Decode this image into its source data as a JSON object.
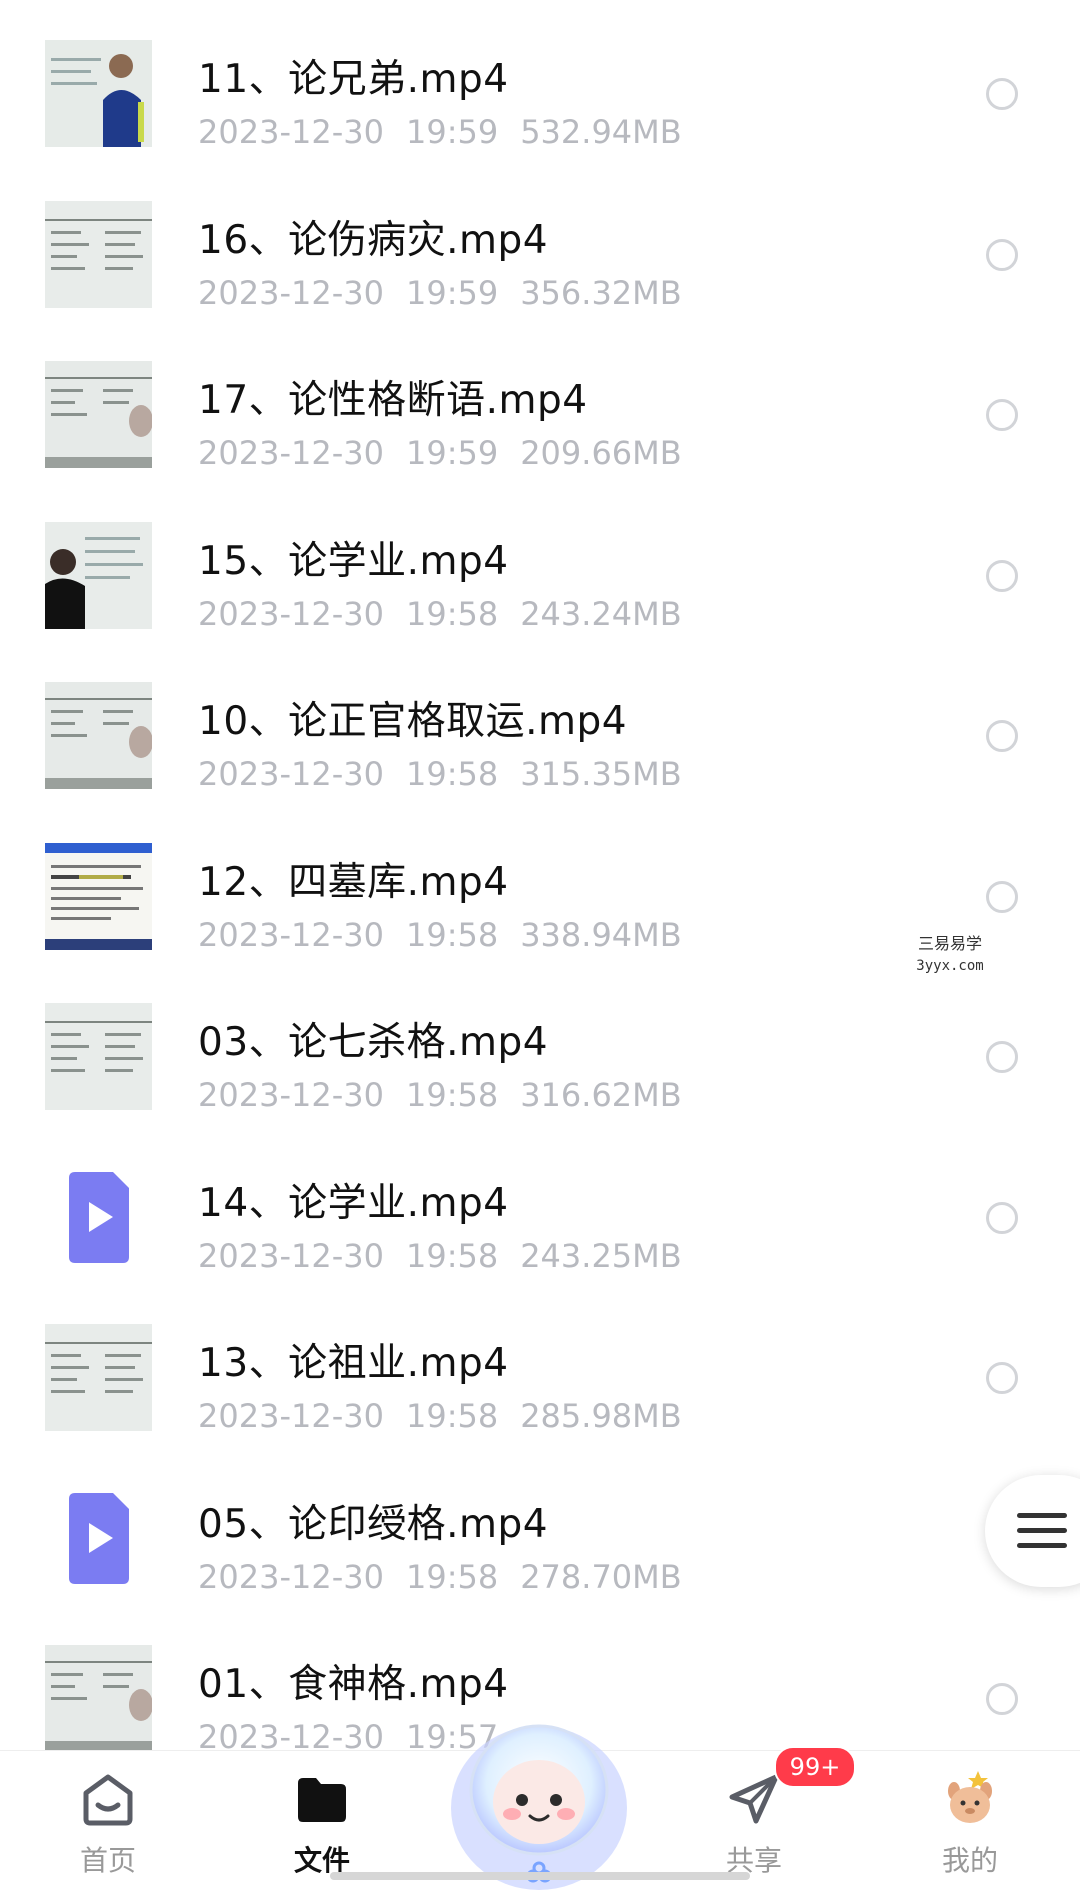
{
  "files": [
    {
      "name": "11、论兄弟.mp4",
      "date": "2023-12-30",
      "time": "19:59",
      "size": "532.94MB",
      "thumb": "man-whiteboard"
    },
    {
      "name": "16、论伤病灾.mp4",
      "date": "2023-12-30",
      "time": "19:59",
      "size": "356.32MB",
      "thumb": "whiteboard-text"
    },
    {
      "name": "17、论性格断语.mp4",
      "date": "2023-12-30",
      "time": "19:59",
      "size": "209.66MB",
      "thumb": "whiteboard-hand"
    },
    {
      "name": "15、论学业.mp4",
      "date": "2023-12-30",
      "time": "19:58",
      "size": "243.24MB",
      "thumb": "man-whiteboard-dark"
    },
    {
      "name": "10、论正官格取运.mp4",
      "date": "2023-12-30",
      "time": "19:58",
      "size": "315.35MB",
      "thumb": "whiteboard-hand"
    },
    {
      "name": "12、四墓库.mp4",
      "date": "2023-12-30",
      "time": "19:58",
      "size": "338.94MB",
      "thumb": "document"
    },
    {
      "name": "03、论七杀格.mp4",
      "date": "2023-12-30",
      "time": "19:58",
      "size": "316.62MB",
      "thumb": "whiteboard-text"
    },
    {
      "name": "14、论学业.mp4",
      "date": "2023-12-30",
      "time": "19:58",
      "size": "243.25MB",
      "thumb": "video-icon"
    },
    {
      "name": "13、论祖业.mp4",
      "date": "2023-12-30",
      "time": "19:58",
      "size": "285.98MB",
      "thumb": "whiteboard-text"
    },
    {
      "name": "05、论印绶格.mp4",
      "date": "2023-12-30",
      "time": "19:58",
      "size": "278.70MB",
      "thumb": "video-icon"
    },
    {
      "name": "01、食神格.mp4",
      "date": "2023-12-30",
      "time": "19:57",
      "size": "",
      "thumb": "whiteboard-hand"
    }
  ],
  "watermark": {
    "line1": "三易易学",
    "line2": "3yyx.com"
  },
  "tabs": [
    {
      "label": "首页",
      "icon": "home-icon"
    },
    {
      "label": "文件",
      "icon": "folder-icon"
    },
    {
      "label": "",
      "icon": "mascot-icon"
    },
    {
      "label": "共享",
      "icon": "share-icon"
    },
    {
      "label": "我的",
      "icon": "profile-avatar-icon"
    }
  ],
  "share_badge": "99+",
  "colors": {
    "accent_purple": "#7b7cf2",
    "badge_red": "#ff3b4a",
    "text_primary": "#111111",
    "text_secondary": "#b7b9bf"
  }
}
